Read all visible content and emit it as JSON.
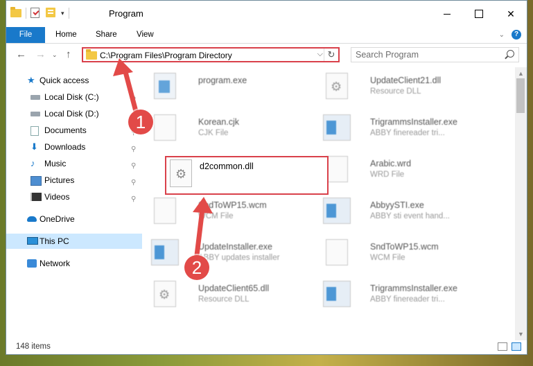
{
  "window": {
    "title": "Program",
    "minimize_glyph": "",
    "close_glyph": "✕"
  },
  "ribbon": {
    "tabs": [
      "File",
      "Home",
      "Share",
      "View"
    ]
  },
  "nav": {
    "back": "←",
    "forward": "→",
    "up": "↑",
    "address": "C:\\Program Files\\Program Directory",
    "address_dropdown": "⌵",
    "refresh": "↻",
    "search_placeholder": "Search Program"
  },
  "sidebar": {
    "items": [
      {
        "label": "Quick access",
        "icon": "star-icon"
      },
      {
        "label": "Local Disk (C:)",
        "icon": "drive-icon"
      },
      {
        "label": "Local Disk (D:)",
        "icon": "drive-icon"
      },
      {
        "label": "Documents",
        "icon": "documents-icon"
      },
      {
        "label": "Downloads",
        "icon": "download-icon"
      },
      {
        "label": "Music",
        "icon": "music-icon"
      },
      {
        "label": "Pictures",
        "icon": "pictures-icon"
      },
      {
        "label": "Videos",
        "icon": "videos-icon"
      },
      {
        "label": "OneDrive",
        "icon": "onedrive-icon"
      },
      {
        "label": "This PC",
        "icon": "this-pc-icon"
      },
      {
        "label": "Network",
        "icon": "network-icon"
      }
    ]
  },
  "files": {
    "left": [
      {
        "name": "program.exe",
        "type": ""
      },
      {
        "name": "Korean.cjk",
        "type": "CJK File"
      },
      {
        "name": "d2common.dll",
        "type": ""
      },
      {
        "name": "SndToWP15.wcm",
        "type": "WCM File"
      },
      {
        "name": "UpdateInstaller.exe",
        "type": "ABBY updates installer"
      },
      {
        "name": "UpdateClient65.dll",
        "type": "Resource DLL"
      }
    ],
    "right": [
      {
        "name": "UpdateClient21.dll",
        "type": "Resource DLL"
      },
      {
        "name": "TrigrammsInstaller.exe",
        "type": "ABBY finereader tri..."
      },
      {
        "name": "Arabic.wrd",
        "type": "WRD File"
      },
      {
        "name": "AbbyySTI.exe",
        "type": "ABBY sti event hand..."
      },
      {
        "name": "SndToWP15.wcm",
        "type": "WCM File"
      },
      {
        "name": "TrigrammsInstaller.exe",
        "type": "ABBY finereader tri..."
      }
    ]
  },
  "status": {
    "item_count": "148 items"
  },
  "annotations": {
    "step1": "1",
    "step2": "2"
  },
  "colors": {
    "accent": "#1979ca",
    "highlight": "#d9404a",
    "callout": "#e24a48"
  }
}
